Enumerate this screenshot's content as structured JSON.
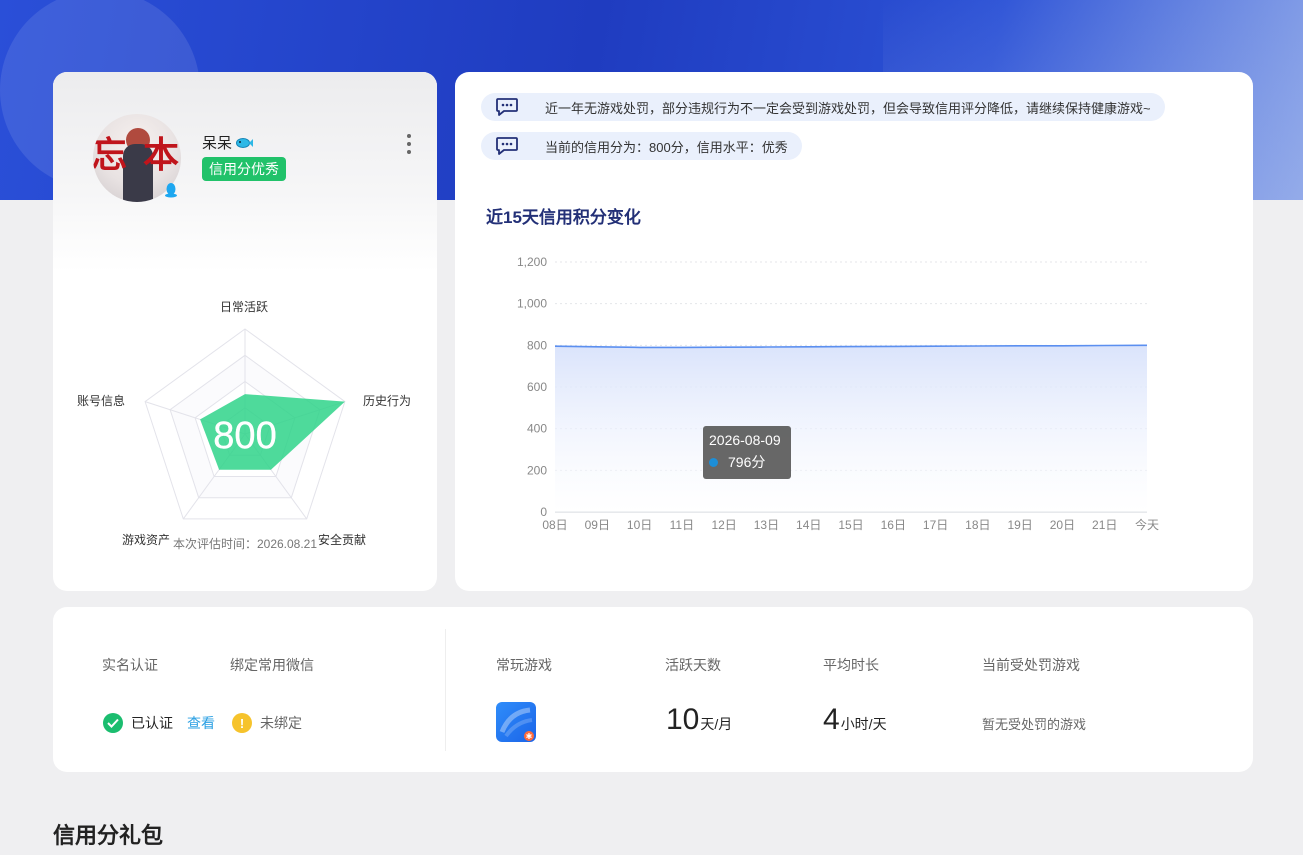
{
  "profile": {
    "username": "呆呆",
    "credit_tag": "信用分优秀",
    "radar": {
      "score_text": "800",
      "axes": [
        "日常活跃",
        "历史行为",
        "安全贡献",
        "游戏资产",
        "账号信息"
      ],
      "values": [
        0.38,
        1.0,
        0.42,
        0.42,
        0.45
      ]
    },
    "eval_time": "本次评估时间：2026.08.21"
  },
  "notices": [
    "近一年无游戏处罚，部分违规行为不一定会受到游戏处罚，但会导致信用评分降低，请继续保持健康游戏~",
    "当前的信用分为：800分，信用水平：优秀"
  ],
  "chart_title": "近15天信用积分变化",
  "chart_data": {
    "type": "area",
    "title": "近15天信用积分变化",
    "categories": [
      "08日",
      "09日",
      "10日",
      "11日",
      "12日",
      "13日",
      "14日",
      "15日",
      "16日",
      "17日",
      "18日",
      "19日",
      "20日",
      "21日",
      "今天"
    ],
    "values": [
      796,
      793,
      790,
      790,
      791,
      792,
      793,
      794,
      795,
      796,
      797,
      798,
      798,
      799,
      800
    ],
    "ylim": [
      0,
      1200
    ],
    "yticks": [
      "0",
      "200",
      "400",
      "600",
      "800",
      "1,000",
      "1,200"
    ],
    "grid": true,
    "color": "#5b8ff0",
    "tooltip": {
      "date": "2026-08-09",
      "value": "796分"
    }
  },
  "stats": {
    "realname_label": "实名认证",
    "wechat_label": "绑定常用微信",
    "verified_text": "已认证",
    "view_link": "查看",
    "unbound_text": "未绑定",
    "frequent_games_label": "常玩游戏",
    "active_days_label": "活跃天数",
    "active_days_value": "10",
    "active_days_unit": "天/月",
    "avg_time_label": "平均时长",
    "avg_time_value": "4",
    "avg_time_unit": "小时/天",
    "penalty_label": "当前受处罚游戏",
    "penalty_text": "暂无受处罚的游戏"
  },
  "gift_section_title": "信用分礼包",
  "colors": {
    "brand_blue": "#2a4fd8",
    "credit_green": "#21c26a",
    "radar_fill": "#2fd38a",
    "link_blue": "#2ba0e3"
  }
}
